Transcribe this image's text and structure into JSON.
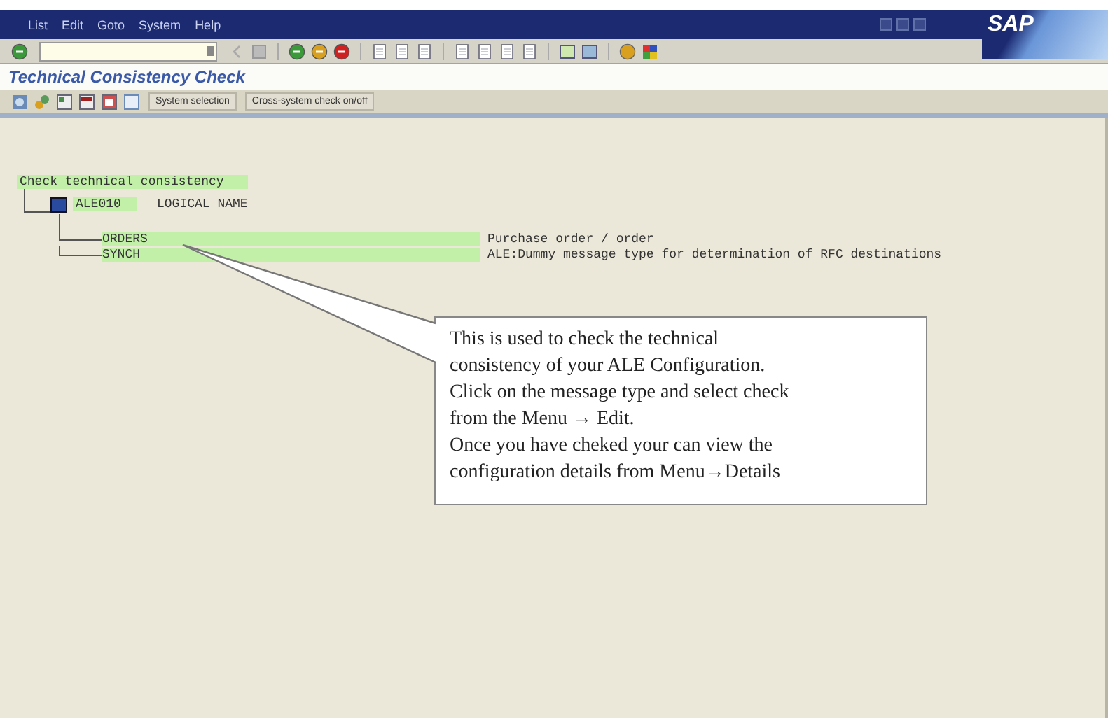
{
  "menu": [
    {
      "label": "List"
    },
    {
      "label": "Edit"
    },
    {
      "label": "Goto"
    },
    {
      "label": "System"
    },
    {
      "label": "Help"
    }
  ],
  "logo": "SAP",
  "title": "Technical Consistency Check",
  "app_toolbar": {
    "buttons": [
      "System selection",
      "Cross-system check on/off"
    ]
  },
  "tree": {
    "label": "Check technical consistency",
    "children": [
      {
        "label": "ALE010",
        "description": "LOGICAL NAME",
        "children": [
          {
            "label": "ORDERS",
            "description": "Purchase order / order"
          },
          {
            "label": "SYNCH",
            "description": "ALE:Dummy message type for determination of RFC destinations"
          }
        ]
      }
    ]
  },
  "callout": {
    "text": "This is used to check the technical\nconsistency of your ALE Configuration.\nClick on the message type and select check\nfrom the Menu → Edit.\nOnce you have cheked your can view the\nconfiguration details from Menu→Details"
  }
}
